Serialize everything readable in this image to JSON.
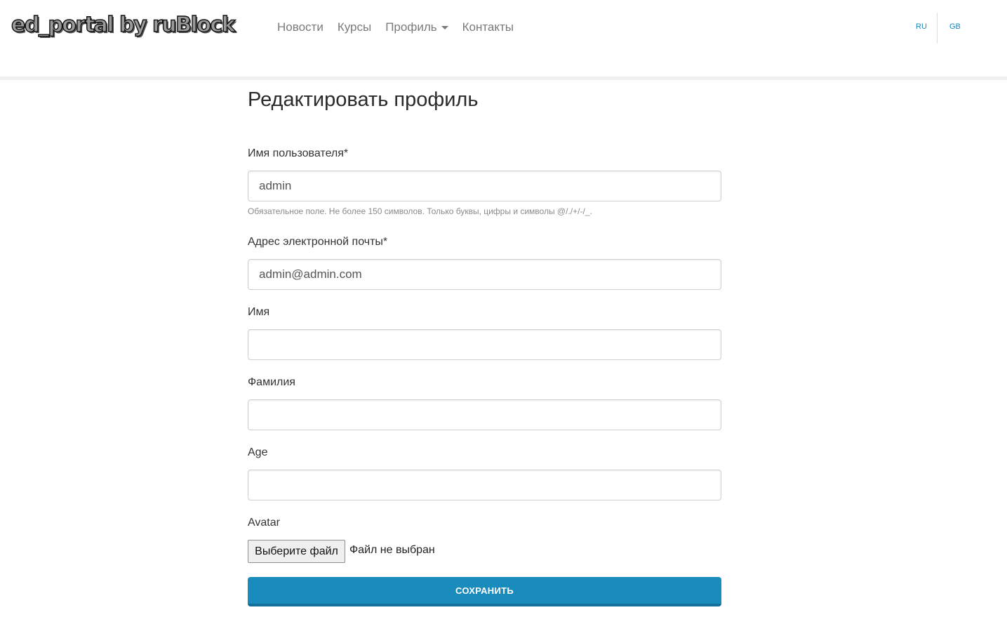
{
  "brand": {
    "text": "ed_portal by ruBlock"
  },
  "nav": {
    "news": "Новости",
    "courses": "Курсы",
    "profile": "Профиль",
    "contacts": "Контакты"
  },
  "lang": {
    "ru": "RU",
    "gb": "GB"
  },
  "page": {
    "title": "Редактировать профиль"
  },
  "form": {
    "username": {
      "label": "Имя пользователя*",
      "value": "admin",
      "help": "Обязательное поле. Не более 150 символов. Только буквы, цифры и символы @/./+/-/_."
    },
    "email": {
      "label": "Адрес электронной почты*",
      "value": "admin@admin.com"
    },
    "first_name": {
      "label": "Имя",
      "value": ""
    },
    "last_name": {
      "label": "Фамилия",
      "value": ""
    },
    "age": {
      "label": "Age",
      "value": ""
    },
    "avatar": {
      "label": "Avatar",
      "button": "Выберите файл",
      "status": "Файл не выбран"
    },
    "submit": "СОХРАНИТЬ"
  },
  "colors": {
    "accent": "#1a8bbd",
    "nav_text": "#7a7a7a",
    "lang_link": "#1a87b8"
  }
}
